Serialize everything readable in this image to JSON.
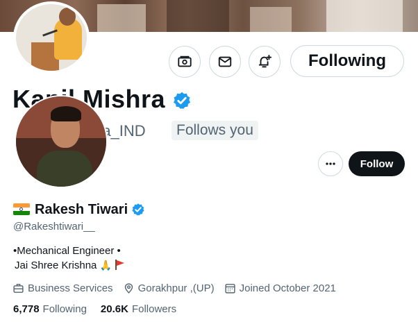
{
  "back_profile": {
    "name": "Kapil Mishra",
    "handle_visible": "ra_IND",
    "follows_you": "Follows you",
    "following_label": "Following",
    "icons": [
      "subscribe-icon",
      "message-icon",
      "notification-add-icon"
    ]
  },
  "front_profile": {
    "name": "Rakesh Tiwari",
    "handle": "@Rakeshtiwari__",
    "follow_label": "Follow",
    "more_icon": "more-horizontal-icon",
    "bio_line1": "•Mechanical Engineer •",
    "bio_line2": "Jai Shree Krishna",
    "meta": {
      "category": "Business Services",
      "location": "Gorakhpur ,(UP)",
      "joined": "Joined October 2021"
    },
    "stats": {
      "following_count": "6,778",
      "following_label": "Following",
      "followers_count": "20.6K",
      "followers_label": "Followers"
    }
  },
  "colors": {
    "verified": "#1d9bf0",
    "follow_button": "#0f1419",
    "secondary_text": "#536471"
  }
}
